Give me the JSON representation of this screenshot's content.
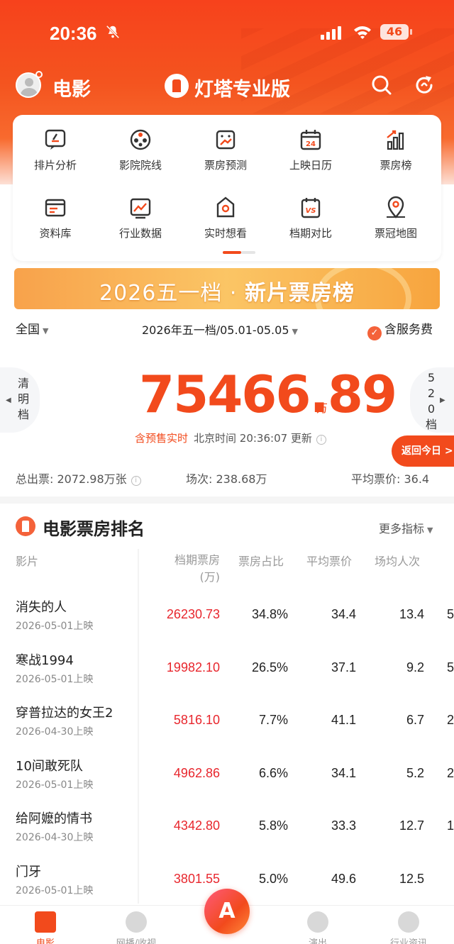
{
  "status_bar": {
    "time": "20:36",
    "battery": "46"
  },
  "header": {
    "title": "电影",
    "brand": "灯塔专业版",
    "colors": {
      "primary": "#f24a1c",
      "avatar_dot": "#f24a1c"
    }
  },
  "menu": {
    "items": [
      {
        "label": "排片分析",
        "icon": "schedule-analysis-icon"
      },
      {
        "label": "影院院线",
        "icon": "cinema-chain-icon"
      },
      {
        "label": "票房预测",
        "icon": "box-office-forecast-icon"
      },
      {
        "label": "上映日历",
        "icon": "release-calendar-icon",
        "badge": "24"
      },
      {
        "label": "票房榜",
        "icon": "box-office-chart-icon"
      },
      {
        "label": "资料库",
        "icon": "database-icon"
      },
      {
        "label": "行业数据",
        "icon": "industry-data-icon"
      },
      {
        "label": "实时想看",
        "icon": "realtime-want-icon"
      },
      {
        "label": "档期对比",
        "icon": "period-compare-icon",
        "badge": "VS"
      },
      {
        "label": "票冠地图",
        "icon": "champion-map-icon"
      }
    ]
  },
  "banner": {
    "prefix": "2026五一档 · ",
    "highlight": "新片票房榜"
  },
  "filters": {
    "region": "全国",
    "period": "2026年五一档/05.01-05.05",
    "service_fee": "含服务费"
  },
  "side_tabs": {
    "left": [
      "清",
      "明",
      "档"
    ],
    "right": [
      "5",
      "2",
      "0",
      "档"
    ]
  },
  "summary": {
    "box_office": "75466.89",
    "unit": "万",
    "presale_label": "含预售实时",
    "update_text": "北京时间 20:36:07 更新",
    "return_today": "返回今日 >",
    "tickets": "总出票: 2072.98万张",
    "shows": "场次: 238.68万",
    "avg_price": "平均票价: 36.4"
  },
  "ranking": {
    "title": "电影票房排名",
    "more": "更多指标",
    "columns": {
      "film": "影片",
      "box_office": "档期票房",
      "box_office_unit": "(万)",
      "share": "票房占比",
      "avg_price": "平均票价",
      "avg_people": "场均人次"
    },
    "rows": [
      {
        "name": "消失的人",
        "date": "2026-05-01上映",
        "box_office": "26230.73",
        "share": "34.8%",
        "avg_price": "34.4",
        "avg_people": "13.4",
        "cut": "5"
      },
      {
        "name": "寒战1994",
        "date": "2026-05-01上映",
        "box_office": "19982.10",
        "share": "26.5%",
        "avg_price": "37.1",
        "avg_people": "9.2",
        "cut": "5"
      },
      {
        "name": "穿普拉达的女王2",
        "date": "2026-04-30上映",
        "box_office": "5816.10",
        "share": "7.7%",
        "avg_price": "41.1",
        "avg_people": "6.7",
        "cut": "2"
      },
      {
        "name": "10间敢死队",
        "date": "2026-05-01上映",
        "box_office": "4962.86",
        "share": "6.6%",
        "avg_price": "34.1",
        "avg_people": "5.2",
        "cut": "2"
      },
      {
        "name": "给阿嬷的情书",
        "date": "2026-04-30上映",
        "box_office": "4342.80",
        "share": "5.8%",
        "avg_price": "33.3",
        "avg_people": "12.7",
        "cut": "1"
      },
      {
        "name": "门牙",
        "date": "2026-05-01上映",
        "box_office": "3801.55",
        "share": "5.0%",
        "avg_price": "49.6",
        "avg_people": "12.5",
        "cut": ""
      }
    ]
  },
  "tabbar": {
    "items": [
      {
        "label": "电影",
        "icon": "movie-tab-icon",
        "active": true
      },
      {
        "label": "网播/收视",
        "icon": "play-tab-icon",
        "active": false
      },
      {
        "label": "",
        "icon": "center-fab-icon",
        "active": false
      },
      {
        "label": "演出",
        "icon": "show-tab-icon",
        "active": false
      },
      {
        "label": "行业资讯",
        "icon": "news-tab-icon",
        "active": false
      }
    ]
  }
}
